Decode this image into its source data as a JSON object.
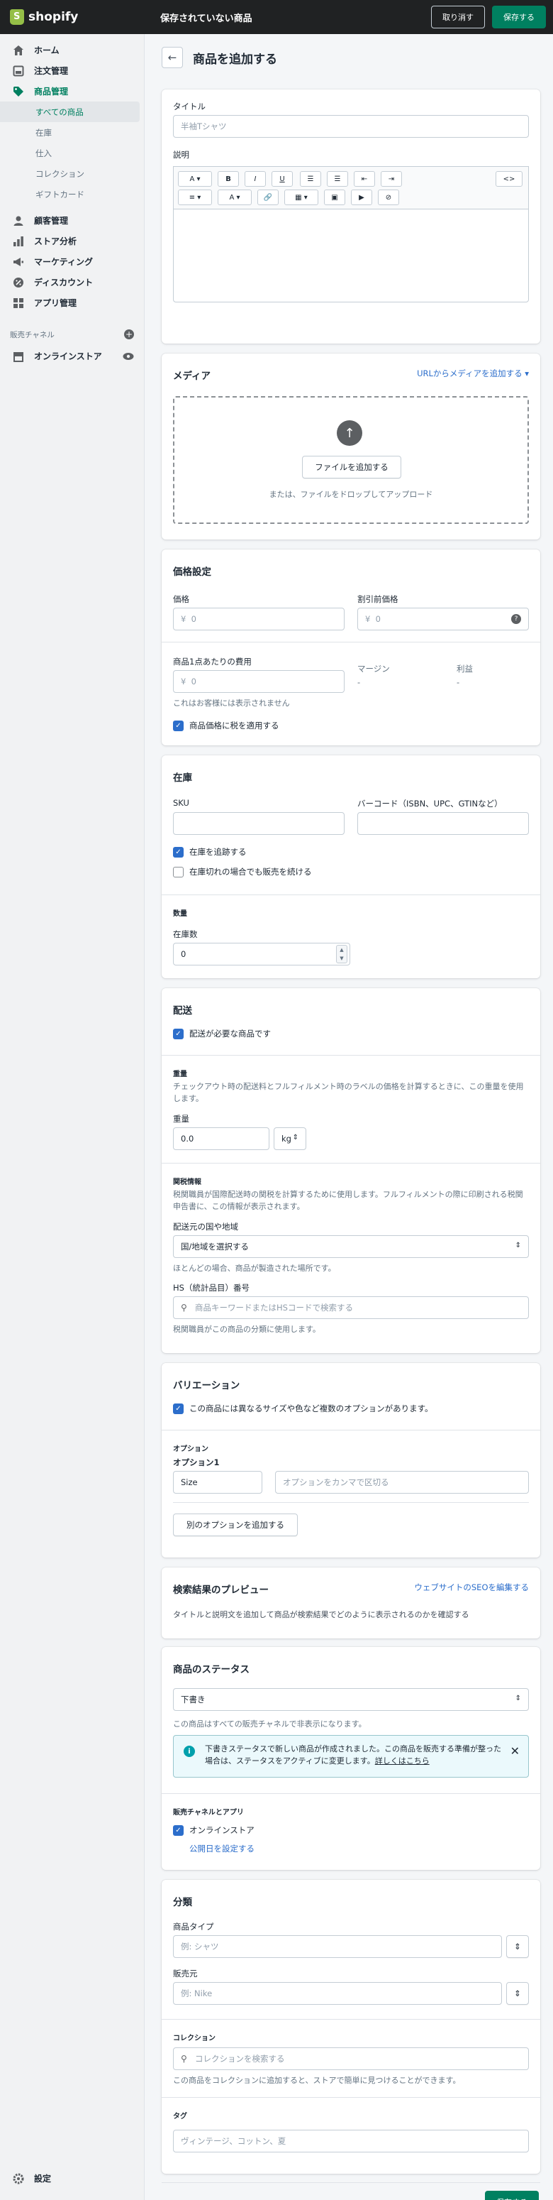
{
  "topbar": {
    "logo": "shopify",
    "title": "保存されていない商品",
    "discard": "取り消す",
    "save": "保存する"
  },
  "sidebar": {
    "items": [
      {
        "label": "ホーム",
        "icon": "home-icon"
      },
      {
        "label": "注文管理",
        "icon": "orders-icon"
      },
      {
        "label": "商品管理",
        "icon": "tag-icon"
      }
    ],
    "sub": [
      "すべての商品",
      "在庫",
      "仕入",
      "コレクション",
      "ギフトカード"
    ],
    "items2": [
      {
        "label": "顧客管理",
        "icon": "customers-icon"
      },
      {
        "label": "ストア分析",
        "icon": "analytics-icon"
      },
      {
        "label": "マーケティング",
        "icon": "marketing-icon"
      },
      {
        "label": "ディスカウント",
        "icon": "discount-icon"
      },
      {
        "label": "アプリ管理",
        "icon": "apps-icon"
      }
    ],
    "channels_label": "販売チャネル",
    "online_store": "オンラインストア",
    "settings": "設定"
  },
  "page": {
    "title": "商品を追加する"
  },
  "title_card": {
    "title_label": "タイトル",
    "title_placeholder": "半袖Tシャツ",
    "desc_label": "説明",
    "html_btn": "<>"
  },
  "media": {
    "heading": "メディア",
    "url_link": "URLからメディアを追加する ▾",
    "add_file": "ファイルを追加する",
    "drop_text": "または、ファイルをドロップしてアップロード"
  },
  "pricing": {
    "heading": "価格設定",
    "price_label": "価格",
    "compare_label": "割引前価格",
    "currency": "¥",
    "zero": "0",
    "cost_label": "商品1点あたりの費用",
    "cost_help": "これはお客様には表示されません",
    "margin_label": "マージン",
    "margin_val": "-",
    "profit_label": "利益",
    "profit_val": "-",
    "tax_label": "商品価格に税を適用する"
  },
  "inventory": {
    "heading": "在庫",
    "sku_label": "SKU",
    "barcode_label": "バーコード（ISBN、UPC、GTINなど）",
    "track_label": "在庫を追跡する",
    "continue_label": "在庫切れの場合でも販売を続ける",
    "qty_heading": "数量",
    "qty_label": "在庫数",
    "qty_val": "0"
  },
  "shipping": {
    "heading": "配送",
    "physical_label": "配送が必要な商品です",
    "weight_heading": "重量",
    "weight_help": "チェックアウト時の配送料とフルフィルメント時のラベルの価格を計算するときに、この重量を使用します。",
    "weight_label": "重量",
    "weight_val": "0.0",
    "weight_unit": "kg",
    "customs_heading": "関税情報",
    "customs_help": "税関職員が国際配送時の関税を計算するために使用します。フルフィルメントの際に印刷される税関申告書に、この情報が表示されます。",
    "origin_label": "配送元の国や地域",
    "origin_val": "国/地域を選択する",
    "origin_help": "ほとんどの場合、商品が製造された場所です。",
    "hs_label": "HS（統計品目）番号",
    "hs_placeholder": "商品キーワードまたはHSコードで検索する",
    "hs_help": "税関職員がこの商品の分類に使用します。"
  },
  "variants": {
    "heading": "バリエーション",
    "multi_label": "この商品には異なるサイズや色など複数のオプションがあります。",
    "options_heading": "オプション",
    "option1": "オプション1",
    "option1_name": "Size",
    "option1_placeholder": "オプションをカンマで区切る",
    "add_option": "別のオプションを追加する"
  },
  "seo": {
    "heading": "検索結果のプレビュー",
    "edit_link": "ウェブサイトのSEOを編集する",
    "text": "タイトルと説明文を追加して商品が検索結果でどのように表示されるのかを確認する"
  },
  "status": {
    "heading": "商品のステータス",
    "value": "下書き",
    "help": "この商品はすべての販売チャネルで非表示になります。",
    "banner": "下書きステータスで新しい商品が作成されました。この商品を販売する準備が整った場合は、ステータスをアクティブに変更します。",
    "banner_link": "詳しくはこちら",
    "channels_heading": "販売チャネルとアプリ",
    "channel": "オンラインストア",
    "publish_link": "公開日を設定する"
  },
  "org": {
    "heading": "分類",
    "type_label": "商品タイプ",
    "type_placeholder": "例: シャツ",
    "vendor_label": "販売元",
    "vendor_placeholder": "例: Nike",
    "collections_heading": "コレクション",
    "collections_placeholder": "コレクションを検索する",
    "collections_help": "この商品をコレクションに追加すると、ストアで簡単に見つけることができます。",
    "tags_heading": "タグ",
    "tags_placeholder": "ヴィンテージ、コットン、夏"
  },
  "footer": {
    "save": "保存する"
  },
  "colors": {
    "accent": "#008060",
    "link": "#2c6ecb",
    "topbar": "#202223"
  }
}
